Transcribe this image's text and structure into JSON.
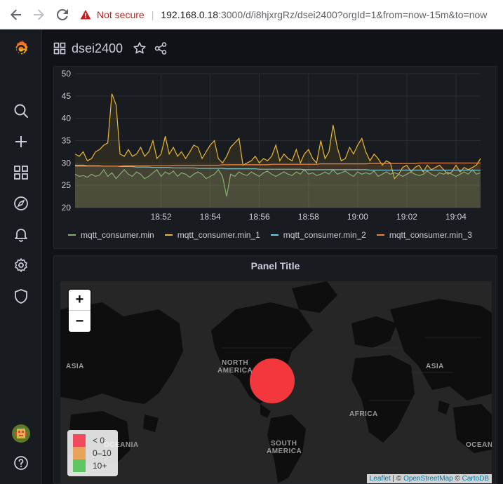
{
  "browser": {
    "security_label": "Not secure",
    "url_host": "192.168.0.18",
    "url_rest": ":3000/d/i8hjxrgRz/dsei2400?orgId=1&from=now-15m&to=now"
  },
  "dashboard": {
    "title": "dsei2400"
  },
  "sidemenu": {
    "items": [
      "search",
      "create",
      "dashboards",
      "explore",
      "alerting",
      "configuration",
      "server-admin"
    ]
  },
  "graph_panel": {
    "legend": [
      {
        "name": "mqtt_consumer.min",
        "color": "#7eb26d"
      },
      {
        "name": "mqtt_consumer.min_1",
        "color": "#eab839"
      },
      {
        "name": "mqtt_consumer.min_2",
        "color": "#6ed0e0"
      },
      {
        "name": "mqtt_consumer.min_3",
        "color": "#ef843c"
      }
    ]
  },
  "chart_data": {
    "type": "line",
    "title": "",
    "xlabel": "",
    "ylabel": "",
    "x_ticks": [
      "18:52",
      "18:54",
      "18:56",
      "18:58",
      "19:00",
      "19:02",
      "19:04"
    ],
    "y_ticks": [
      20,
      25,
      30,
      35,
      40,
      45,
      50
    ],
    "ylim": [
      20,
      50
    ],
    "xlim_minutes": [
      18.5,
      19.08
    ],
    "grid": true,
    "legend_position": "bottom",
    "fill": true,
    "x": [
      18.5,
      18.67,
      18.83,
      19.0,
      19.17,
      19.33,
      19.5,
      19.67,
      19.83,
      20.0,
      20.17,
      20.33,
      20.5,
      20.67,
      20.83,
      21.0,
      21.17,
      21.33,
      21.5,
      21.67,
      21.83,
      22.0,
      22.17,
      22.33,
      22.5,
      22.67,
      22.83,
      23.0,
      23.17,
      23.33,
      23.5,
      23.67,
      23.83,
      24.0,
      24.17,
      24.33,
      24.5,
      24.67,
      24.83,
      25.0,
      25.17,
      25.33,
      25.5,
      25.67,
      25.83,
      26.0,
      26.17,
      26.33,
      26.5,
      26.67,
      26.83,
      27.0,
      27.17,
      27.33,
      27.5,
      27.67,
      27.83,
      28.0,
      28.17,
      28.33,
      28.5,
      28.67,
      28.83,
      29.0,
      29.17,
      29.33,
      29.5,
      29.67,
      29.83,
      30.0,
      30.17,
      30.33,
      30.5,
      30.67,
      30.83,
      31.0,
      31.17,
      31.33,
      31.5,
      31.67,
      31.83,
      32.0,
      32.17,
      32.33,
      32.5,
      32.67,
      32.83,
      33.0,
      33.17,
      33.33,
      33.5,
      33.67,
      33.83,
      34.0,
      34.17,
      34.33,
      34.5,
      34.67,
      34.83,
      35.0
    ],
    "series": [
      {
        "name": "mqtt_consumer.min",
        "color": "#7eb26d",
        "values": [
          27.5,
          27.0,
          27.2,
          26.8,
          27.5,
          27.0,
          27.3,
          28.5,
          27.0,
          27.8,
          26.5,
          27.5,
          28.5,
          27.5,
          27.0,
          28.0,
          27.5,
          26.5,
          27.0,
          27.8,
          28.5,
          27.0,
          28.0,
          27.5,
          28.2,
          27.0,
          27.8,
          27.5,
          26.8,
          27.5,
          28.0,
          27.5,
          26.5,
          27.0,
          27.5,
          28.5,
          27.0,
          22.5,
          27.5,
          27.0,
          28.0,
          27.5,
          27.2,
          28.0,
          27.5,
          27.0,
          27.8,
          28.2,
          27.5,
          27.0,
          27.5,
          28.0,
          27.5,
          27.2,
          28.0,
          27.5,
          28.5,
          27.5,
          27.8,
          27.2,
          27.5,
          28.0,
          27.5,
          28.5,
          27.5,
          27.8,
          28.2,
          27.5,
          27.0,
          28.0,
          27.5,
          27.8,
          27.5,
          28.2,
          27.0,
          27.5,
          28.0,
          27.5,
          27.8,
          27.5,
          27.0,
          27.5,
          28.0,
          27.5,
          27.2,
          27.5,
          28.2,
          27.5,
          27.0,
          27.8,
          27.5,
          28.0,
          27.5,
          27.0,
          27.5,
          28.0,
          27.5,
          28.5,
          27.5,
          27.8
        ]
      },
      {
        "name": "mqtt_consumer.min_1",
        "color": "#eab839",
        "values": [
          32.0,
          31.5,
          32.5,
          30.5,
          31.0,
          32.5,
          33.0,
          34.0,
          34.5,
          45.5,
          43.0,
          32.0,
          31.5,
          33.0,
          31.5,
          32.0,
          33.5,
          31.5,
          32.5,
          35.0,
          31.0,
          32.0,
          36.0,
          32.0,
          33.5,
          31.5,
          32.5,
          31.0,
          32.5,
          34.0,
          33.5,
          31.0,
          32.5,
          34.0,
          35.0,
          31.0,
          30.0,
          31.5,
          33.5,
          34.5,
          35.5,
          29.5,
          30.0,
          30.5,
          31.5,
          30.0,
          31.0,
          30.5,
          31.5,
          34.0,
          30.5,
          32.0,
          31.0,
          30.5,
          33.0,
          30.0,
          32.0,
          33.0,
          31.0,
          30.0,
          35.0,
          31.0,
          32.5,
          38.5,
          33.5,
          30.5,
          31.0,
          33.5,
          32.0,
          34.0,
          35.5,
          32.5,
          30.5,
          32.0,
          31.0,
          29.5,
          30.5,
          30.0,
          26.5,
          27.5,
          29.0,
          29.5,
          28.0,
          29.0,
          29.5,
          28.0,
          29.5,
          28.5,
          29.0,
          29.5,
          28.5,
          27.5,
          28.0,
          29.5,
          28.0,
          29.0,
          28.5,
          29.0,
          29.5,
          31.0
        ]
      },
      {
        "name": "mqtt_consumer.min_2",
        "color": "#6ed0e0",
        "values": [
          29.5,
          29.5,
          29.5,
          29.4,
          29.4,
          29.4,
          29.4,
          29.3,
          29.3,
          29.3,
          29.3,
          29.2,
          29.2,
          29.2,
          29.2,
          29.1,
          29.1,
          29.1,
          29.1,
          29.0,
          29.0,
          29.0,
          29.0,
          29.0,
          28.9,
          28.9,
          28.9,
          28.9,
          28.9,
          28.9,
          28.8,
          28.8,
          28.8,
          28.8,
          28.8,
          28.8,
          28.8,
          28.7,
          28.7,
          28.7,
          28.7,
          28.7,
          28.7,
          28.7,
          28.7,
          28.6,
          28.6,
          28.6,
          28.6,
          28.6,
          28.6,
          28.6,
          28.6,
          28.6,
          28.6,
          28.6,
          28.5,
          28.5,
          28.5,
          28.5,
          28.5,
          28.5,
          28.5,
          28.5,
          28.5,
          28.5,
          28.5,
          28.5,
          28.5,
          28.5,
          28.5,
          28.5,
          28.4,
          28.4,
          28.4,
          28.4,
          28.4,
          28.4,
          28.4,
          28.4,
          28.4,
          28.4,
          28.4,
          28.4,
          28.4,
          28.4,
          28.4,
          28.4,
          28.4,
          28.4,
          28.4,
          28.4,
          28.4,
          28.4,
          28.4,
          28.4,
          28.4,
          28.4,
          28.4,
          28.4
        ]
      },
      {
        "name": "mqtt_consumer.min_3",
        "color": "#ef843c",
        "values": [
          29.3,
          29.3,
          29.3,
          29.3,
          29.3,
          29.3,
          29.3,
          29.3,
          29.3,
          29.3,
          29.3,
          29.3,
          29.4,
          29.4,
          29.4,
          29.4,
          29.4,
          29.4,
          29.4,
          29.4,
          29.4,
          29.4,
          29.4,
          29.4,
          29.5,
          29.5,
          29.5,
          29.5,
          29.5,
          29.5,
          29.5,
          29.5,
          29.5,
          29.5,
          29.5,
          29.5,
          29.6,
          29.6,
          29.6,
          29.6,
          29.6,
          29.6,
          29.6,
          29.6,
          29.6,
          29.6,
          29.6,
          29.6,
          29.7,
          29.7,
          29.7,
          29.7,
          29.7,
          29.7,
          29.7,
          29.7,
          29.7,
          29.7,
          29.7,
          29.7,
          29.8,
          29.8,
          29.8,
          29.8,
          29.8,
          29.8,
          29.8,
          29.8,
          29.8,
          29.8,
          29.8,
          29.8,
          29.9,
          29.9,
          29.9,
          29.9,
          29.9,
          29.9,
          29.9,
          29.9,
          29.9,
          29.9,
          29.9,
          29.9,
          30.0,
          30.0,
          30.0,
          30.0,
          30.0,
          30.0,
          30.0,
          30.0,
          30.0,
          30.0,
          30.0,
          30.0,
          30.0,
          30.0,
          30.0,
          30.0
        ]
      }
    ]
  },
  "map_panel": {
    "title": "Panel Title",
    "zoom_in": "+",
    "zoom_out": "−",
    "labels": {
      "asia_left": "ASIA",
      "north_america_1": "NORTH",
      "north_america_2": "AMERICA",
      "asia_right": "ASIA",
      "africa": "AFRICA",
      "oceania_left": "OCEANIA",
      "oceania_right": "OCEAN",
      "south_america_1": "SOUTH",
      "south_america_2": "AMERICA"
    },
    "marker_color": "#f2383d",
    "legend": [
      {
        "label": "< 0",
        "color": "#f2495c"
      },
      {
        "label": "0–10",
        "color": "#e8a35a"
      },
      {
        "label": "10+",
        "color": "#5fc561"
      }
    ],
    "attribution": {
      "leaflet": "Leaflet",
      "sep1": " | © ",
      "osm": "OpenStreetMap",
      "sep2": " © ",
      "carto": "CartoDB"
    }
  }
}
